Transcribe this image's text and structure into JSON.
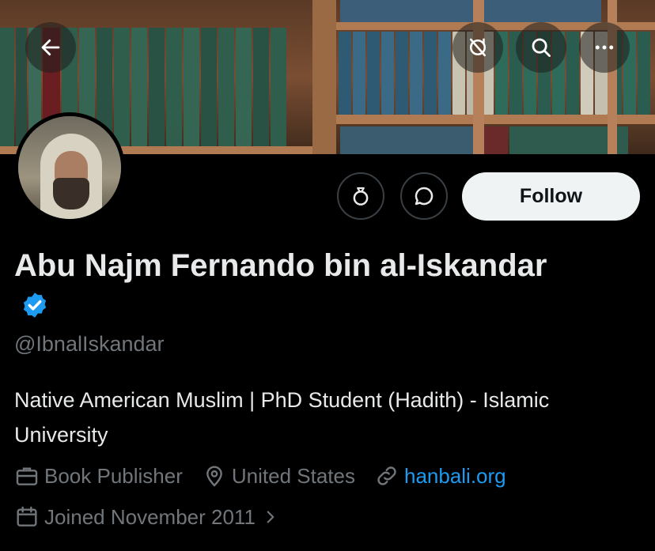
{
  "header": {
    "back_icon": "back-arrow-icon",
    "actions": [
      "no-translate-icon",
      "search-icon",
      "more-icon"
    ]
  },
  "profile": {
    "name": "Abu Najm Fernando bin al-Iskandar",
    "handle": "@IbnalIskandar",
    "verified": true,
    "bio": "Native American Muslim | PhD Student (Hadith) - Islamic University",
    "category": "Book Publisher",
    "location": "United States",
    "website": "hanbali.org",
    "joined": "Joined November 2011"
  },
  "actions": {
    "follow_label": "Follow"
  },
  "colors": {
    "background": "#000000",
    "accent": "#1d9bf0",
    "muted": "#71767b",
    "text": "#e7e9ea",
    "follow_bg": "#eff3f4"
  }
}
